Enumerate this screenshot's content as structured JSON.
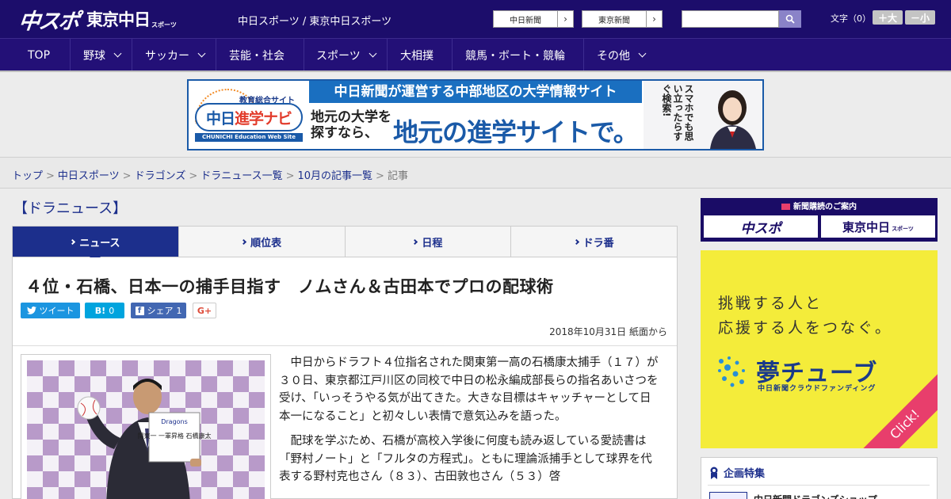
{
  "header": {
    "logo_chuspo": "中スポ",
    "logo_tokyo": "東京中日",
    "logo_sports": "スポーツ",
    "site_name": "中日スポーツ / 東京中日スポーツ",
    "link_chunichi": "中日新聞",
    "link_tokyo": "東京新聞",
    "search_placeholder": "",
    "font_size_label": "文字（0）",
    "font_larger": "＋大",
    "font_smaller": "－小"
  },
  "nav": {
    "items": [
      {
        "label": "TOP",
        "has_dropdown": false
      },
      {
        "label": "野球",
        "has_dropdown": true
      },
      {
        "label": "サッカー",
        "has_dropdown": true
      },
      {
        "label": "芸能・社会",
        "has_dropdown": false
      },
      {
        "label": "スポーツ",
        "has_dropdown": true
      },
      {
        "label": "大相撲",
        "has_dropdown": false
      },
      {
        "label": "競馬・ボート・競輪",
        "has_dropdown": false
      },
      {
        "label": "その他",
        "has_dropdown": true
      }
    ]
  },
  "banner": {
    "tagline": "教育総合サイト",
    "logo_text_a": "中日",
    "logo_text_b": "進学ナビ",
    "logo_sub": "CHUNICHI Education Web Site",
    "strip": "中日新聞が運営する中部地区の大学情報サイト",
    "lead": "地元の大学を探すなら、",
    "big": "地元の進学サイトで。",
    "vertical": "スマホでも思い立ったらすぐ検索!"
  },
  "breadcrumb": {
    "items": [
      "トップ",
      "中日スポーツ",
      "ドラゴンズ",
      "ドラニュース一覧",
      "10月の記事一覧"
    ],
    "current": "記事"
  },
  "section_heading": "【ドラニュース】",
  "tabs": [
    {
      "label": "ニュース",
      "active": true
    },
    {
      "label": "順位表",
      "active": false
    },
    {
      "label": "日程",
      "active": false
    },
    {
      "label": "ドラ番",
      "active": false
    }
  ],
  "article": {
    "headline": "４位・石橋、日本一の捕手目指す　ノムさん＆古田本でプロの配球術",
    "share": {
      "tweet_label": "ツイート",
      "hatena_label": "B!",
      "hatena_count": "0",
      "facebook_label": "シェア",
      "facebook_count": "1",
      "gplus_label": "G+"
    },
    "dateline": "2018年10月31日 紙面から",
    "photo_sign": "関東一 一軍昇格 石橋康太",
    "photo_team": "Dragons",
    "paragraphs": [
      "中日からドラフト４位指名された関東第一高の石橋康太捕手（１７）が３０日、東京都江戸川区の同校で中日の松永編成部長らの指名あいさつを受け、「いっそうやる気が出てきた。大きな目標はキャッチャーとして日本一になること」と初々しい表情で意気込みを語った。",
      "配球を学ぶため、石橋が高校入学後に何度も読み返している愛読書は「野村ノート」と「フルタの方程式」。ともに理論派捕手として球界を代表する野村克也さん（８３）、古田敦也さん（５３）啓"
    ]
  },
  "sidebar": {
    "subscription_title": "新聞購読のご案内",
    "sub_chuspo": "中スポ",
    "sub_tokyo": "東京中日",
    "sub_tokyo_small": "スポーツ",
    "yume_copy_1": "挑戦する人と",
    "yume_copy_2": "応援する人をつなぐ。",
    "yume_logo": "夢チューブ",
    "yume_sub": "中日新聞クラウドファンディング",
    "yume_click": "Click!",
    "feature_title": "企画特集",
    "feature_item": "中日新聞ドラゴンズショップ"
  },
  "colors": {
    "header_bg": "#1c0d6b",
    "nav_bg": "#231077",
    "link": "#1c2f8c",
    "banner_blue": "#1a6fc0",
    "yume_yellow": "#f4ec3a"
  }
}
